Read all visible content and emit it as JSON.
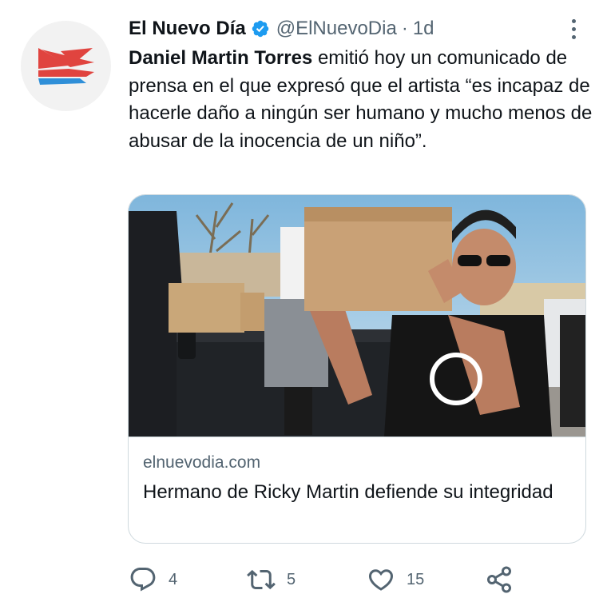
{
  "tweet": {
    "author": {
      "display_name": "El Nuevo Día",
      "handle": "@ElNuevoDia",
      "verified": true,
      "avatar_icon": "el-nuevo-dia-logo"
    },
    "separator": "·",
    "time": "1d",
    "text": {
      "mention": "Daniel Martin Torres",
      "body": " emitió hoy un comunicado de prensa en el que expresó que el artista “es incapaz de hacerle daño a ningún ser humano y mucho menos de abusar de la inocencia de un niño”."
    },
    "card": {
      "domain": "elnuevodia.com",
      "title": "Hermano de Ricky Martin defiende su integridad"
    },
    "actions": {
      "replies": "4",
      "retweets": "5",
      "likes": "15"
    }
  },
  "colors": {
    "verified_blue": "#1d9bf0",
    "secondary_text": "#536471",
    "logo_red": "#e0443f",
    "logo_blue": "#2f8fd8"
  }
}
